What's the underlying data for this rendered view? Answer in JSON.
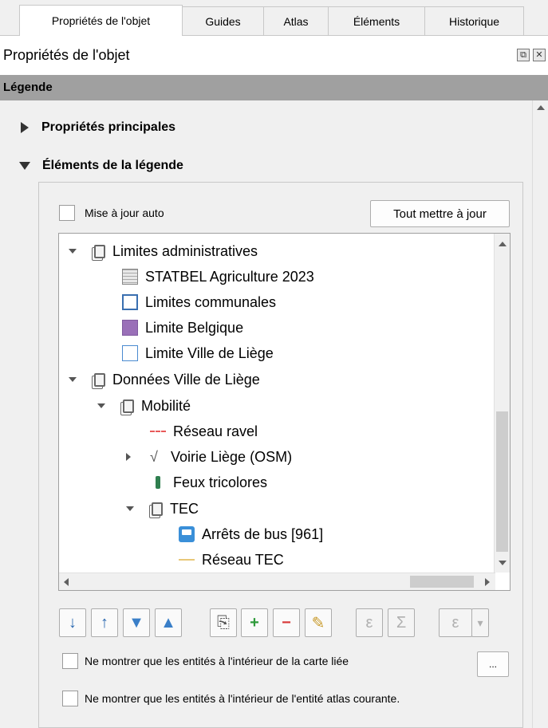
{
  "tabs": [
    {
      "label": "Propriétés de l'objet"
    },
    {
      "label": "Guides"
    },
    {
      "label": "Atlas"
    },
    {
      "label": "Éléments"
    },
    {
      "label": "Historique"
    }
  ],
  "panel_title": "Propriétés de l'objet",
  "section_title": "Légende",
  "groups": {
    "main_props": "Propriétés principales",
    "legend_items": "Éléments de la légende"
  },
  "auto_update_label": "Mise à jour auto",
  "update_all_button": "Tout mettre à jour",
  "tree": [
    {
      "label": "Limites administratives",
      "icon": "layer-group-icon"
    },
    {
      "label": "STATBEL Agriculture 2023",
      "icon": "table-icon"
    },
    {
      "label": "Limites communales",
      "icon": "polygon-outline-icon"
    },
    {
      "label": "Limite Belgique",
      "icon": "polygon-fill-icon"
    },
    {
      "label": "Limite Ville de Liège",
      "icon": "polygon-outline-icon"
    },
    {
      "label": "Données Ville de Liège",
      "icon": "layer-group-icon"
    },
    {
      "label": "Mobilité",
      "icon": "layer-group-icon"
    },
    {
      "label": "Réseau ravel",
      "icon": "dashed-line-icon"
    },
    {
      "label": "Voirie Liège (OSM)",
      "icon": "line-vertex-icon"
    },
    {
      "label": "Feux tricolores",
      "icon": "traffic-light-icon"
    },
    {
      "label": "TEC",
      "icon": "layer-group-icon"
    },
    {
      "label": "Arrêts de bus [961]",
      "icon": "bus-icon"
    },
    {
      "label": "Réseau TEC",
      "icon": "line-icon"
    }
  ],
  "toolbar": {
    "symbols": [
      "↓",
      "↑",
      "▼",
      "▲",
      "⎘",
      "+",
      "−",
      "✎",
      "ε",
      "Σ",
      "ε",
      "▾"
    ]
  },
  "filter_map_label": "Ne montrer que les entités à l'intérieur de la carte liée",
  "filter_map_button": "...",
  "filter_atlas_label": "Ne montrer que les entités à l'intérieur de l'entité atlas courante."
}
